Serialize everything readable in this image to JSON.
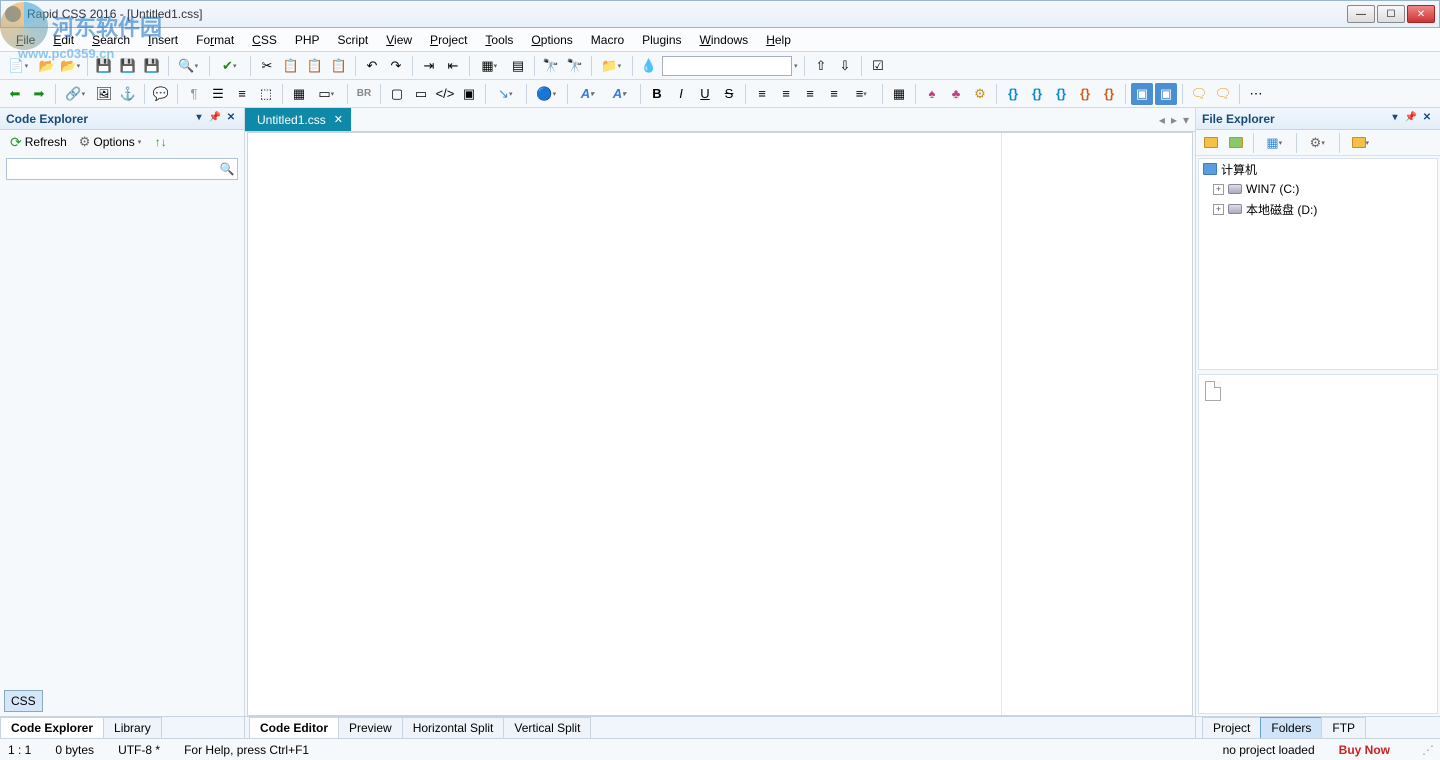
{
  "window": {
    "title": "Rapid CSS 2016 - [Untitled1.css]"
  },
  "watermark": {
    "text1": "河东软件园",
    "text2": "www.pc0359.cn"
  },
  "menu": [
    "File",
    "Edit",
    "Search",
    "Insert",
    "Format",
    "CSS",
    "PHP",
    "Script",
    "View",
    "Project",
    "Tools",
    "Options",
    "Macro",
    "Plugins",
    "Windows",
    "Help"
  ],
  "left_panel": {
    "title": "Code Explorer",
    "refresh": "Refresh",
    "options": "Options",
    "search_placeholder": "",
    "css_badge": "CSS",
    "tabs": [
      "Code Explorer",
      "Library"
    ],
    "active_tab": 0
  },
  "editor": {
    "tab_label": "Untitled1.css",
    "bottom_tabs": [
      "Code Editor",
      "Preview",
      "Horizontal Split",
      "Vertical Split"
    ],
    "active_bottom": 0
  },
  "right_panel": {
    "title": "File Explorer",
    "tree": {
      "root": "计算机",
      "drives": [
        "WIN7 (C:)",
        "本地磁盘 (D:)"
      ]
    },
    "tabs": [
      "Project",
      "Folders",
      "FTP"
    ],
    "active_tab": 1
  },
  "status": {
    "pos": "1 : 1",
    "size": "0 bytes",
    "encoding": "UTF-8 *",
    "help": "For Help, press Ctrl+F1",
    "project": "no project loaded",
    "buy": "Buy Now"
  }
}
